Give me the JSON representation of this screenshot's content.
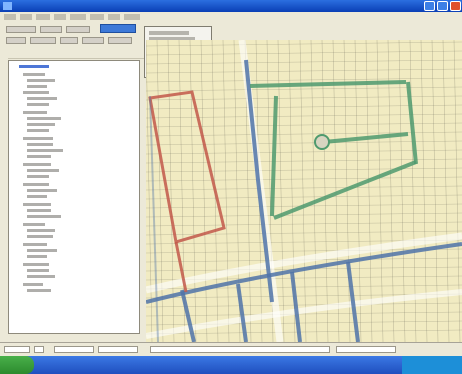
{
  "window": {
    "title": "",
    "buttons": [
      "minimize-button",
      "maximize-button",
      "close-button"
    ]
  },
  "menubar": {
    "items": []
  },
  "toolbar": {
    "dropdown_value": ""
  },
  "popup_menu": {
    "items": []
  },
  "layer_panel": {
    "items": []
  },
  "map": {
    "colors": {
      "background": "#f1ebc2",
      "parcel_lines": "#6b6a5a",
      "route_green": "#4f9a6e",
      "route_blue": "#4f73a8",
      "route_red": "#c2584a"
    }
  },
  "statusbar": {
    "fields": []
  },
  "taskbar": {
    "start_label": ""
  }
}
